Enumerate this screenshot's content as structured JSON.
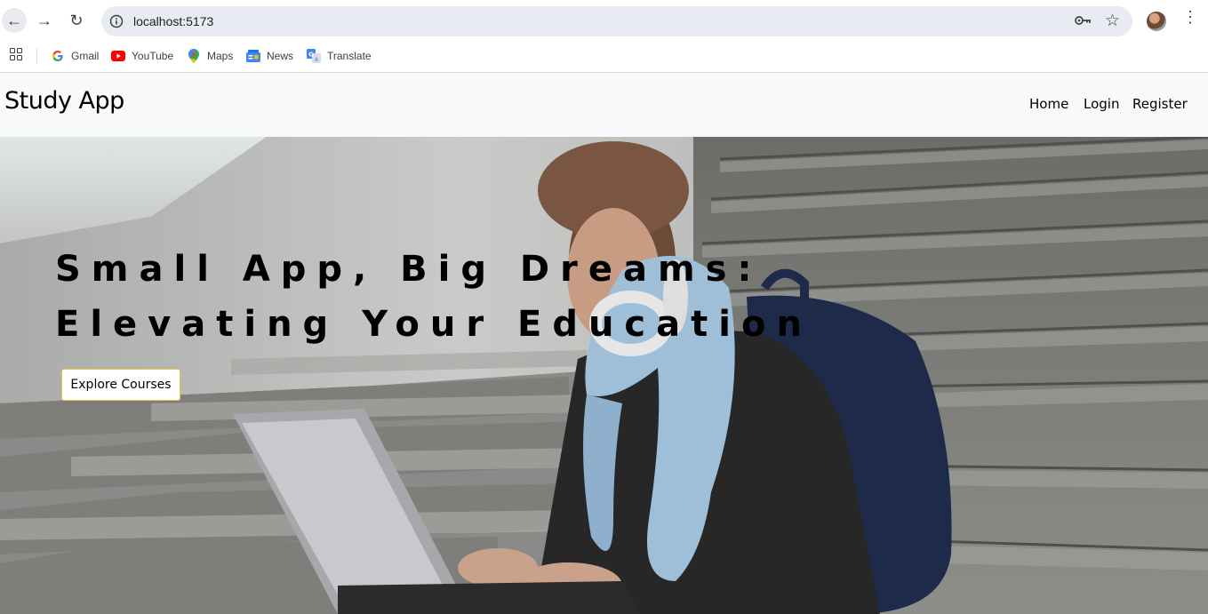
{
  "browser": {
    "url": "localhost:5173",
    "bookmarks": [
      {
        "label": "Gmail",
        "icon": "google-icon"
      },
      {
        "label": "YouTube",
        "icon": "youtube-icon"
      },
      {
        "label": "Maps",
        "icon": "maps-icon"
      },
      {
        "label": "News",
        "icon": "news-icon"
      },
      {
        "label": "Translate",
        "icon": "translate-icon"
      }
    ]
  },
  "navbar": {
    "brand": "Study App",
    "links": [
      "Home",
      "Login",
      "Register"
    ]
  },
  "hero": {
    "title_line1": "Small App, Big Dreams:",
    "title_line2": "Elevating Your Education",
    "cta_label": "Explore Courses",
    "image": "student-with-laptop-on-stairs"
  },
  "colors": {
    "navbar_bg": "#f8f9fb",
    "cta_border": "#f0c33c"
  }
}
